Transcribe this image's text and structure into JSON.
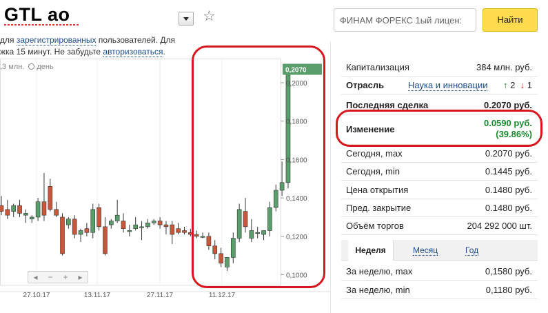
{
  "header": {
    "title": "GTL ao",
    "notice_prefix": "для",
    "notice_link1": "зарегистрированных",
    "notice_mid": "пользователей. Для",
    "notice_line2": "жка 15 минут. Не забудьте",
    "notice_link2": "авторизоваться",
    "notice_end": "."
  },
  "search": {
    "value": "ФИНАМ ФОРЕКС 1ый лицен:",
    "button_label": "Найти"
  },
  "chart": {
    "meta_volume": ",3 млн.",
    "meta_period": "день",
    "last_price_label": "0,2070",
    "y_ticks": [
      "0,2000",
      "0,1800",
      "0,1600",
      "0,1400",
      "0,1200",
      "0,1000"
    ],
    "x_ticks": [
      "27.10.17",
      "13.11.17",
      "27.11.17",
      "11.12.17"
    ],
    "zoom_minus": "−",
    "zoom_plus": "+",
    "zoom_left": "◂",
    "zoom_right": "▸"
  },
  "chart_data": {
    "type": "candlestick",
    "xlabel": "",
    "ylabel": "",
    "ylim": [
      0.095,
      0.215
    ],
    "x_ticks": [
      "27.10.17",
      "13.11.17",
      "27.11.17",
      "11.12.17"
    ],
    "up_color": "#5a9e6b",
    "down_color": "#c9573a",
    "candles": [
      {
        "o": 0.136,
        "h": 0.141,
        "l": 0.131,
        "c": 0.133
      },
      {
        "o": 0.134,
        "h": 0.139,
        "l": 0.129,
        "c": 0.131
      },
      {
        "o": 0.133,
        "h": 0.137,
        "l": 0.13,
        "c": 0.136
      },
      {
        "o": 0.136,
        "h": 0.139,
        "l": 0.13,
        "c": 0.132
      },
      {
        "o": 0.131,
        "h": 0.134,
        "l": 0.127,
        "c": 0.132
      },
      {
        "o": 0.129,
        "h": 0.131,
        "l": 0.127,
        "c": 0.13
      },
      {
        "o": 0.13,
        "h": 0.14,
        "l": 0.128,
        "c": 0.138
      },
      {
        "o": 0.138,
        "h": 0.153,
        "l": 0.128,
        "c": 0.131
      },
      {
        "o": 0.146,
        "h": 0.15,
        "l": 0.133,
        "c": 0.134
      },
      {
        "o": 0.134,
        "h": 0.138,
        "l": 0.13,
        "c": 0.131
      },
      {
        "o": 0.13,
        "h": 0.132,
        "l": 0.11,
        "c": 0.111
      },
      {
        "o": 0.126,
        "h": 0.13,
        "l": 0.124,
        "c": 0.129
      },
      {
        "o": 0.129,
        "h": 0.131,
        "l": 0.119,
        "c": 0.121
      },
      {
        "o": 0.121,
        "h": 0.124,
        "l": 0.117,
        "c": 0.123
      },
      {
        "o": 0.124,
        "h": 0.127,
        "l": 0.12,
        "c": 0.122
      },
      {
        "o": 0.122,
        "h": 0.137,
        "l": 0.119,
        "c": 0.134
      },
      {
        "o": 0.135,
        "h": 0.137,
        "l": 0.123,
        "c": 0.125
      },
      {
        "o": 0.125,
        "h": 0.13,
        "l": 0.11,
        "c": 0.111
      },
      {
        "o": 0.126,
        "h": 0.129,
        "l": 0.124,
        "c": 0.128
      },
      {
        "o": 0.128,
        "h": 0.139,
        "l": 0.127,
        "c": 0.131
      },
      {
        "o": 0.128,
        "h": 0.132,
        "l": 0.122,
        "c": 0.124
      },
      {
        "o": 0.123,
        "h": 0.126,
        "l": 0.12,
        "c": 0.123
      },
      {
        "o": 0.124,
        "h": 0.13,
        "l": 0.123,
        "c": 0.126
      },
      {
        "o": 0.125,
        "h": 0.128,
        "l": 0.118,
        "c": 0.125
      },
      {
        "o": 0.125,
        "h": 0.129,
        "l": 0.124,
        "c": 0.127
      },
      {
        "o": 0.127,
        "h": 0.129,
        "l": 0.126,
        "c": 0.128
      },
      {
        "o": 0.128,
        "h": 0.13,
        "l": 0.124,
        "c": 0.126
      },
      {
        "o": 0.126,
        "h": 0.128,
        "l": 0.121,
        "c": 0.125
      },
      {
        "o": 0.126,
        "h": 0.128,
        "l": 0.116,
        "c": 0.121
      },
      {
        "o": 0.124,
        "h": 0.127,
        "l": 0.121,
        "c": 0.122
      },
      {
        "o": 0.123,
        "h": 0.125,
        "l": 0.121,
        "c": 0.122
      },
      {
        "o": 0.122,
        "h": 0.124,
        "l": 0.12,
        "c": 0.121
      },
      {
        "o": 0.121,
        "h": 0.123,
        "l": 0.119,
        "c": 0.12
      },
      {
        "o": 0.12,
        "h": 0.122,
        "l": 0.119,
        "c": 0.12
      },
      {
        "o": 0.12,
        "h": 0.122,
        "l": 0.113,
        "c": 0.115
      },
      {
        "o": 0.115,
        "h": 0.118,
        "l": 0.108,
        "c": 0.111
      },
      {
        "o": 0.111,
        "h": 0.114,
        "l": 0.104,
        "c": 0.106
      },
      {
        "o": 0.104,
        "h": 0.109,
        "l": 0.102,
        "c": 0.109
      },
      {
        "o": 0.109,
        "h": 0.122,
        "l": 0.106,
        "c": 0.119
      },
      {
        "o": 0.119,
        "h": 0.137,
        "l": 0.117,
        "c": 0.134
      },
      {
        "o": 0.133,
        "h": 0.14,
        "l": 0.122,
        "c": 0.125
      },
      {
        "o": 0.119,
        "h": 0.129,
        "l": 0.117,
        "c": 0.123
      },
      {
        "o": 0.122,
        "h": 0.125,
        "l": 0.119,
        "c": 0.122
      },
      {
        "o": 0.121,
        "h": 0.123,
        "l": 0.118,
        "c": 0.123
      },
      {
        "o": 0.123,
        "h": 0.138,
        "l": 0.12,
        "c": 0.135
      },
      {
        "o": 0.135,
        "h": 0.147,
        "l": 0.133,
        "c": 0.144
      },
      {
        "o": 0.144,
        "h": 0.159,
        "l": 0.141,
        "c": 0.148
      },
      {
        "o": 0.148,
        "h": 0.207,
        "l": 0.145,
        "c": 0.207
      }
    ]
  },
  "panel": {
    "rows": [
      {
        "label": "Капитализация",
        "value": "384 млн. руб."
      },
      {
        "label": "Отрасль",
        "link": "Наука и инновации",
        "up_count": "2",
        "down_count": "1"
      },
      {
        "label": "Последняя сделка",
        "value": "0.2070 руб."
      },
      {
        "label": "Изменение",
        "value1": "0.0590 руб.",
        "value2": "(39.86%)"
      },
      {
        "label": "Сегодня, max",
        "value": "0.2070 руб."
      },
      {
        "label": "Сегодня, min",
        "value": "0.1445 руб."
      },
      {
        "label": "Цена открытия",
        "value": "0.1480 руб."
      },
      {
        "label": "Пред. закрытие",
        "value": "0.1480 руб."
      },
      {
        "label": "Объём торгов",
        "value": "204 292 000 шт."
      }
    ],
    "tabs": [
      "Неделя",
      "Месяц",
      "Год"
    ],
    "week_rows": [
      {
        "label": "За неделю, max",
        "value": "0,1580 руб."
      },
      {
        "label": "За неделю, min",
        "value": "0,1180 руб."
      }
    ]
  }
}
